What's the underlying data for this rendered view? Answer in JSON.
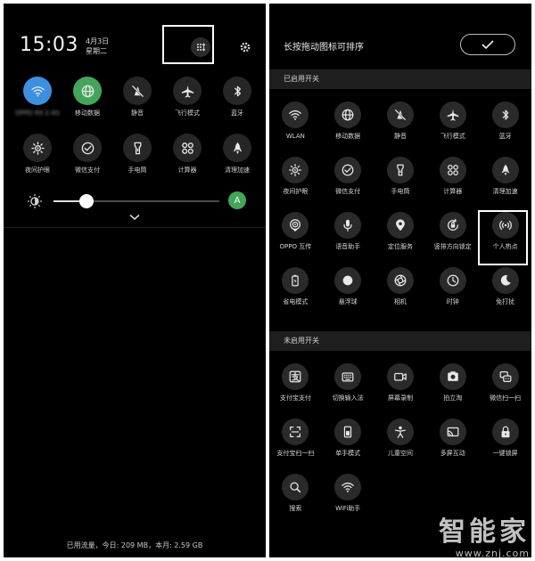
{
  "left": {
    "time": "15:03",
    "date_line1": "4月3日",
    "date_line2": "星期二",
    "tiles_row1": [
      {
        "label": "OPPO R9 2.4G",
        "icon": "wifi-icon",
        "state": "on-blue",
        "blurred": true
      },
      {
        "label": "移动数据",
        "icon": "globe-icon",
        "state": "on-green"
      },
      {
        "label": "静音",
        "icon": "mute-icon"
      },
      {
        "label": "飞行模式",
        "icon": "airplane-icon"
      },
      {
        "label": "蓝牙",
        "icon": "bluetooth-icon"
      }
    ],
    "tiles_row2": [
      {
        "label": "夜间护眼",
        "icon": "eye-care-icon"
      },
      {
        "label": "微信支付",
        "icon": "wechat-pay-icon"
      },
      {
        "label": "手电筒",
        "icon": "flashlight-icon"
      },
      {
        "label": "计算器",
        "icon": "calculator-icon"
      },
      {
        "label": "清理加速",
        "icon": "rocket-icon"
      }
    ],
    "brightness_level": 0.2,
    "auto_label": "A",
    "data_usage": "已用流量，今日: 209 MB，本月: 2.59 GB"
  },
  "right": {
    "title": "长按拖动图标可排序",
    "enabled_section": "已启用开关",
    "disabled_section": "未启用开关",
    "enabled_tiles": [
      {
        "label": "WLAN",
        "icon": "wifi-icon"
      },
      {
        "label": "移动数据",
        "icon": "globe-icon"
      },
      {
        "label": "静音",
        "icon": "mute-icon"
      },
      {
        "label": "飞行模式",
        "icon": "airplane-icon"
      },
      {
        "label": "蓝牙",
        "icon": "bluetooth-icon"
      },
      {
        "label": "夜间护眼",
        "icon": "eye-care-icon"
      },
      {
        "label": "微信支付",
        "icon": "wechat-pay-icon"
      },
      {
        "label": "手电筒",
        "icon": "flashlight-icon"
      },
      {
        "label": "计算器",
        "icon": "calculator-icon"
      },
      {
        "label": "清理加速",
        "icon": "rocket-icon"
      },
      {
        "label": "OPPO 互传",
        "icon": "share-icon"
      },
      {
        "label": "语音助手",
        "icon": "microphone-icon"
      },
      {
        "label": "定位服务",
        "icon": "location-icon"
      },
      {
        "label": "竖排方向锁定",
        "icon": "rotation-lock-icon"
      },
      {
        "label": "个人热点",
        "icon": "hotspot-icon"
      },
      {
        "label": "省电模式",
        "icon": "battery-icon"
      },
      {
        "label": "悬浮球",
        "icon": "floating-ball-icon"
      },
      {
        "label": "相机",
        "icon": "camera-icon"
      },
      {
        "label": "时钟",
        "icon": "clock-icon"
      },
      {
        "label": "免打扰",
        "icon": "moon-icon"
      }
    ],
    "disabled_tiles": [
      {
        "label": "支付宝支付",
        "icon": "alipay-icon"
      },
      {
        "label": "切换输入法",
        "icon": "keyboard-icon"
      },
      {
        "label": "屏幕录制",
        "icon": "screen-record-icon"
      },
      {
        "label": "拍立淘",
        "icon": "photo-search-icon"
      },
      {
        "label": "微信扫一扫",
        "icon": "wechat-scan-icon"
      },
      {
        "label": "支付宝扫一扫",
        "icon": "scan-icon"
      },
      {
        "label": "单手模式",
        "icon": "one-hand-icon"
      },
      {
        "label": "儿童空间",
        "icon": "kid-icon"
      },
      {
        "label": "多屏互动",
        "icon": "cast-icon"
      },
      {
        "label": "一键锁屏",
        "icon": "lock-icon"
      },
      {
        "label": "搜索",
        "icon": "search-icon"
      },
      {
        "label": "WiFi助手",
        "icon": "wifi-assist-icon"
      }
    ]
  },
  "watermark": {
    "text": "智能家",
    "url": "www.znj.com"
  }
}
